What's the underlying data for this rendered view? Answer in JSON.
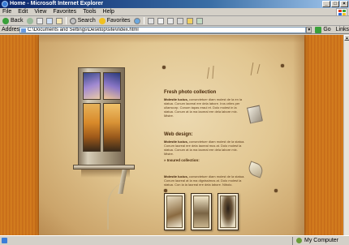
{
  "window": {
    "title": "Home - Microsoft Internet Explorer",
    "buttons": [
      "_",
      "□",
      "×"
    ]
  },
  "menubar": {
    "items": [
      "File",
      "Edit",
      "View",
      "Favorites",
      "Tools",
      "Help"
    ]
  },
  "toolbar": {
    "back_label": "Back",
    "search_label": "Search",
    "favorites_label": "Favorites"
  },
  "address": {
    "label": "Address",
    "url": "C:\\Documents and Settings\\Desktop\\site\\index.html",
    "go_label": "Go",
    "links_label": "Links"
  },
  "page": {
    "section1": {
      "title": "Fresh photo collection",
      "lead": "Molestie lucius,",
      "body": "consectetuer diam molest de la en la statua. Conum laoreal ere dela labore. Iros crites per ullamcorp. Conum tapas eraul et. Dolo molest in la statua. Conum at la ma laoreal ere dela labore mix. Mistre."
    },
    "section2": {
      "title": "Web design:",
      "lead": "Molestie lucius,",
      "body": "consectetuer diam molest de la statua. Conum laoreal ere dela laoreal mus at. Dolo molest la statua. Conum at la ma laoreal ere dela labore mix. Mistre.",
      "subtitle": "» Insured collection:"
    },
    "section3": {
      "lead": "Molestie lucius,",
      "body": "consectetuer diam molest de la statua. Conum laoreal at la ma dignissimos at. Dolo molest la statua. Con la la laoreal ere dela labore. Nibolo."
    }
  },
  "statusbar": {
    "zone": "My Computer"
  }
}
